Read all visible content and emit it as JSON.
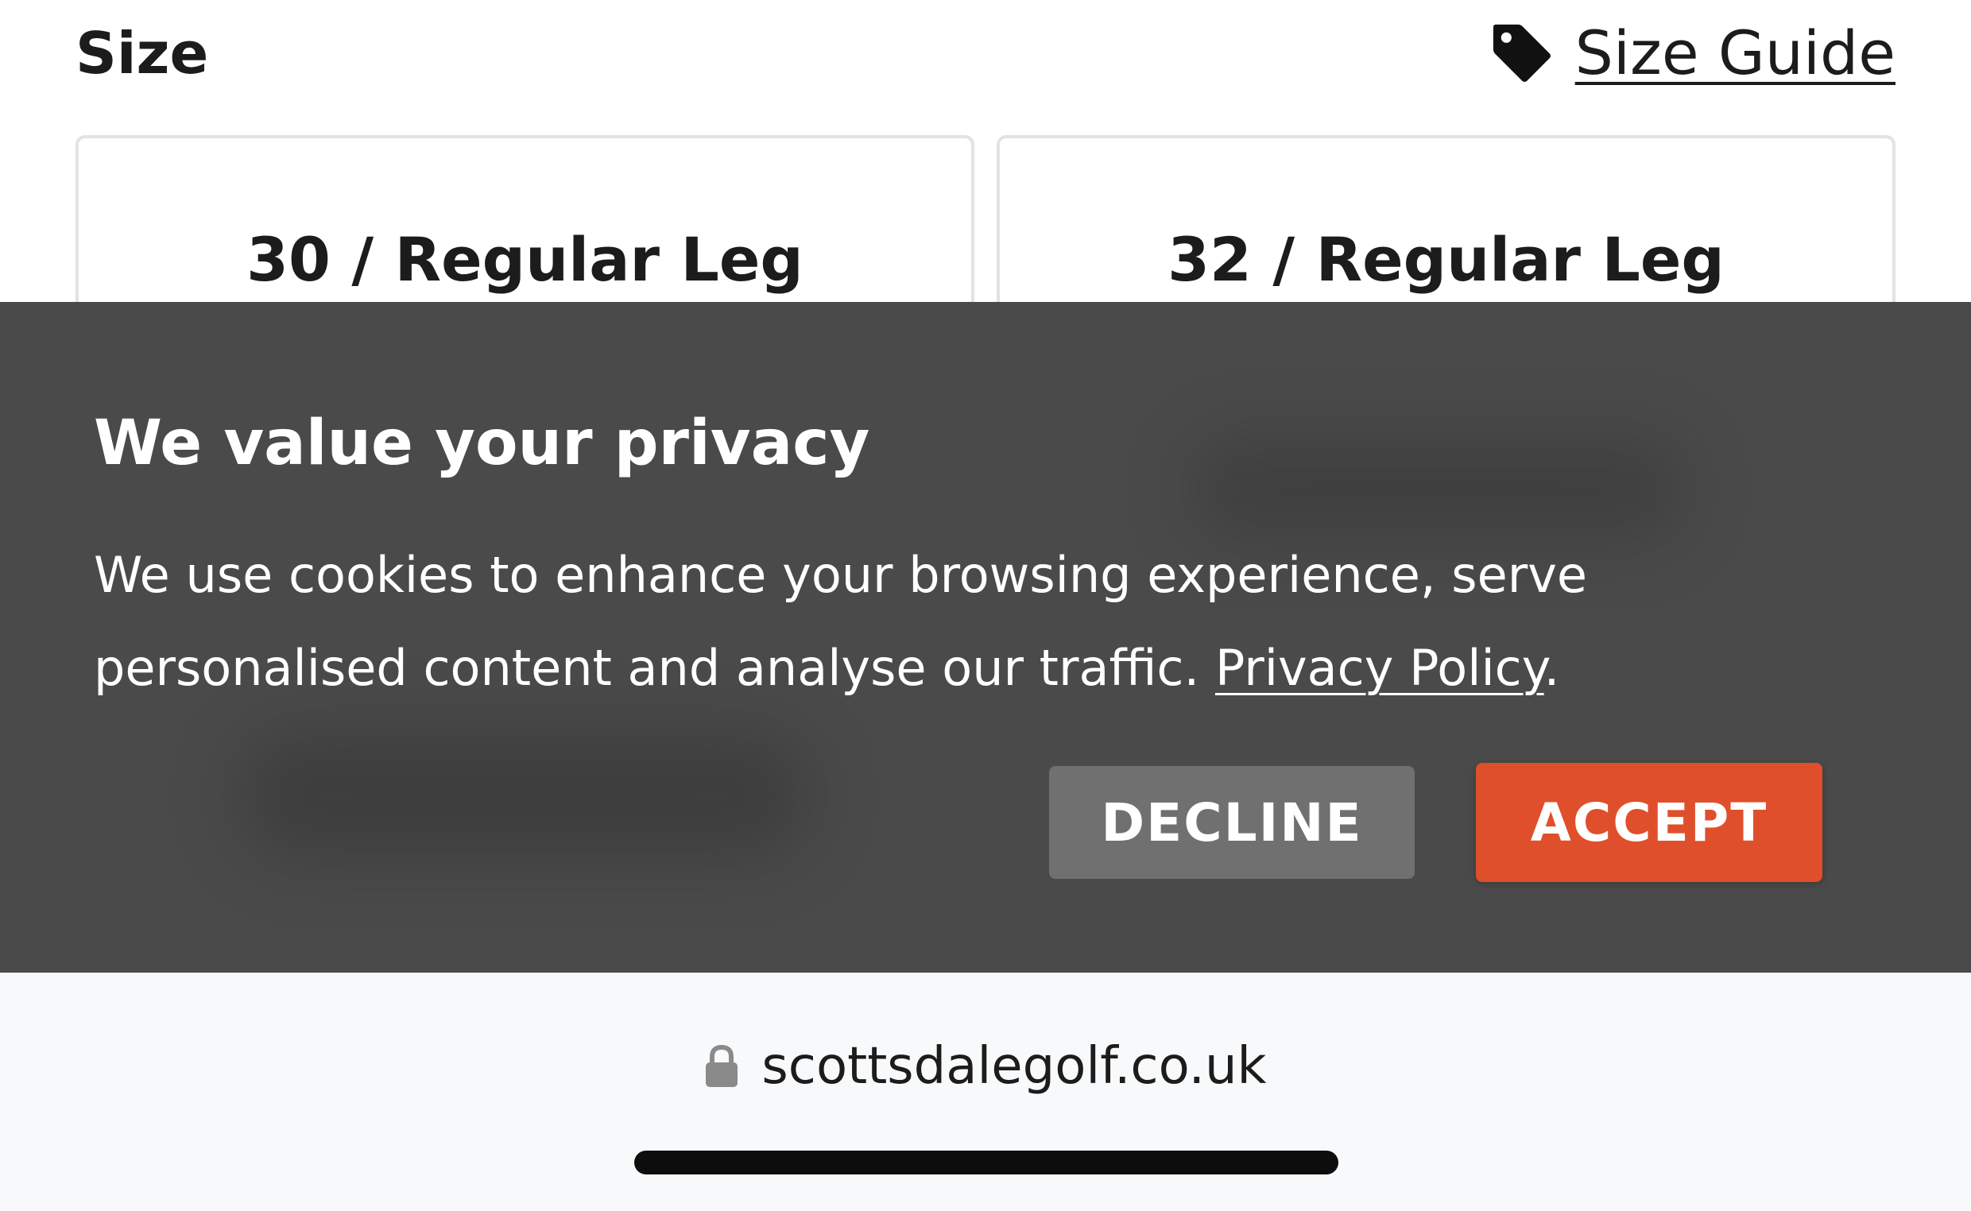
{
  "size_section": {
    "title": "Size",
    "size_guide_label": "Size Guide",
    "size_guide_icon": "tag-icon",
    "options": [
      {
        "label": "30 / Regular Leg"
      },
      {
        "label": "32 / Regular Leg"
      }
    ]
  },
  "cookie_banner": {
    "title": "We value your privacy",
    "text": "We use cookies to enhance your browsing experience, serve personalised content and analyse our traffic. ",
    "privacy_link_label": "Privacy Policy",
    "text_end": ".",
    "decline_label": "DECLINE",
    "accept_label": "ACCEPT",
    "colors": {
      "background": "#4a4a4a",
      "decline": "#707070",
      "accept": "#e04f2b"
    }
  },
  "browser_bar": {
    "url": "scottsdalegolf.co.uk",
    "lock_icon": "lock-icon"
  }
}
